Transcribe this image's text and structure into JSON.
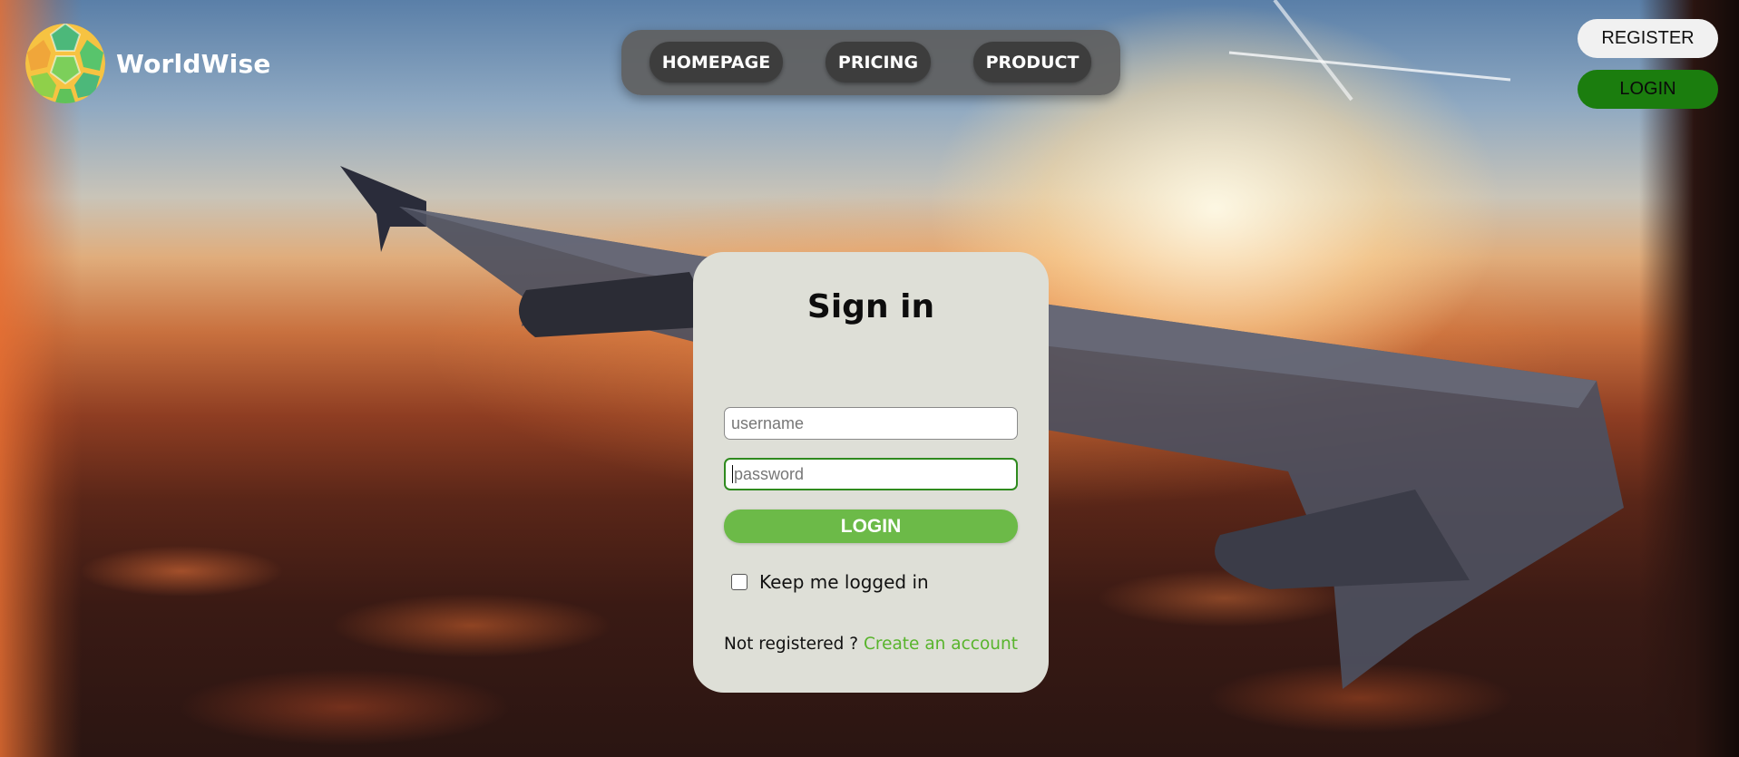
{
  "brand": {
    "name": "WorldWise",
    "logo_icon": "geodesic-globe-logo"
  },
  "nav": {
    "items": [
      {
        "label": "HOMEPAGE"
      },
      {
        "label": "PRICING"
      },
      {
        "label": "PRODUCT"
      }
    ]
  },
  "header_actions": {
    "register_label": "REGISTER",
    "login_label": "LOGIN"
  },
  "signin": {
    "title": "Sign in",
    "username_placeholder": "username",
    "password_placeholder": "password",
    "submit_label": "LOGIN",
    "keep_logged_in_label": "Keep me logged in",
    "keep_logged_in_checked": false,
    "not_registered_text": "Not registered ?",
    "create_account_link": "Create an account"
  },
  "colors": {
    "accent_green": "#6cba48",
    "link_green": "#58b42c",
    "top_login_green": "#1b7d0e",
    "card_bg": "#dedfd7",
    "nav_bg": "#5f5f5f",
    "nav_button_bg": "#3d3d3d"
  }
}
